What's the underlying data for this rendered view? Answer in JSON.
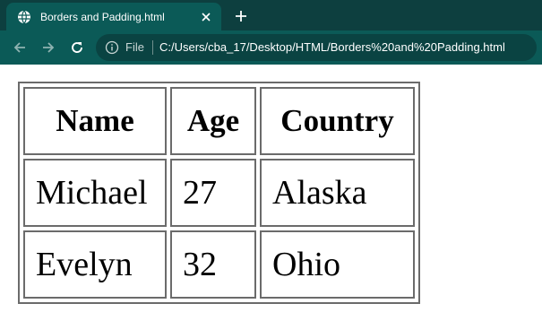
{
  "browser": {
    "tab": {
      "title": "Borders and Padding.html",
      "favicon": "globe-icon"
    },
    "toolbar": {
      "security_label": "File",
      "url": "C:/Users/cba_17/Desktop/HTML/Borders%20and%20Padding.html"
    },
    "colors": {
      "tabstrip": "#0d3f3f",
      "toolbar": "#0b5a57",
      "omnibox": "#0a4342"
    }
  },
  "table": {
    "headers": [
      "Name",
      "Age",
      "Country"
    ],
    "rows": [
      [
        "Michael",
        "27",
        "Alaska"
      ],
      [
        "Evelyn",
        "32",
        "Ohio"
      ]
    ]
  }
}
